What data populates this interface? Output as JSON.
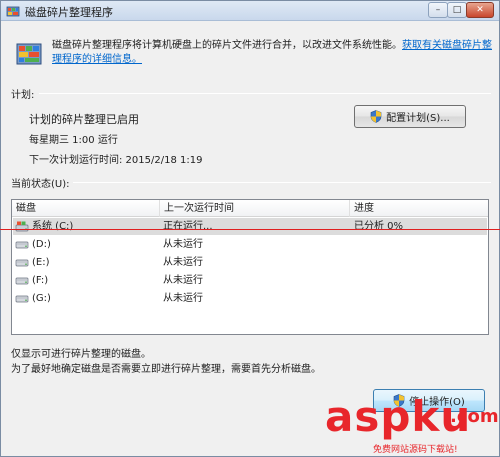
{
  "window": {
    "title": "磁盘碎片整理程序",
    "controls": {
      "minimize": "–",
      "maximize": "□",
      "close": "✕"
    }
  },
  "intro": {
    "text": "磁盘碎片整理程序将计算机硬盘上的碎片文件进行合并，以改进文件系统性能。",
    "link": "获取有关磁盘碎片整理程序的详细信息。"
  },
  "schedule": {
    "label": "计划:",
    "enabled_text": "计划的碎片整理已启用",
    "run_time": "每星期三  1:00 运行",
    "next_run": "下一次计划运行时间: 2015/2/18 1:19",
    "configure_button": "配置计划(S)..."
  },
  "status": {
    "label": "当前状态(U):",
    "columns": [
      "磁盘",
      "上一次运行时间",
      "进度"
    ],
    "rows": [
      {
        "disk": "系统 (C:)",
        "last_run": "正在运行...",
        "progress": "已分析 0%"
      },
      {
        "disk": "(D:)",
        "last_run": "从未运行",
        "progress": ""
      },
      {
        "disk": "(E:)",
        "last_run": "从未运行",
        "progress": ""
      },
      {
        "disk": "(F:)",
        "last_run": "从未运行",
        "progress": ""
      },
      {
        "disk": "(G:)",
        "last_run": "从未运行",
        "progress": ""
      }
    ]
  },
  "notes": {
    "line1": "仅显示可进行碎片整理的磁盘。",
    "line2": "为了最好地确定磁盘是否需要立即进行碎片整理，需要首先分析磁盘。"
  },
  "footer": {
    "stop_button": "停止操作(O)"
  },
  "watermark": {
    "brand": "aspku",
    "tld": ".com",
    "tagline": "免费网站源码下载站!"
  },
  "colors": {
    "link": "#0066cc",
    "annotation_line": "#e02020",
    "watermark": "#e8262b",
    "selected_row": "#dcdcdc"
  },
  "icons": {
    "title": "defrag-icon",
    "header": "defrag-icon",
    "shield": "uac-shield-icon",
    "drive": "hard-drive-icon"
  }
}
